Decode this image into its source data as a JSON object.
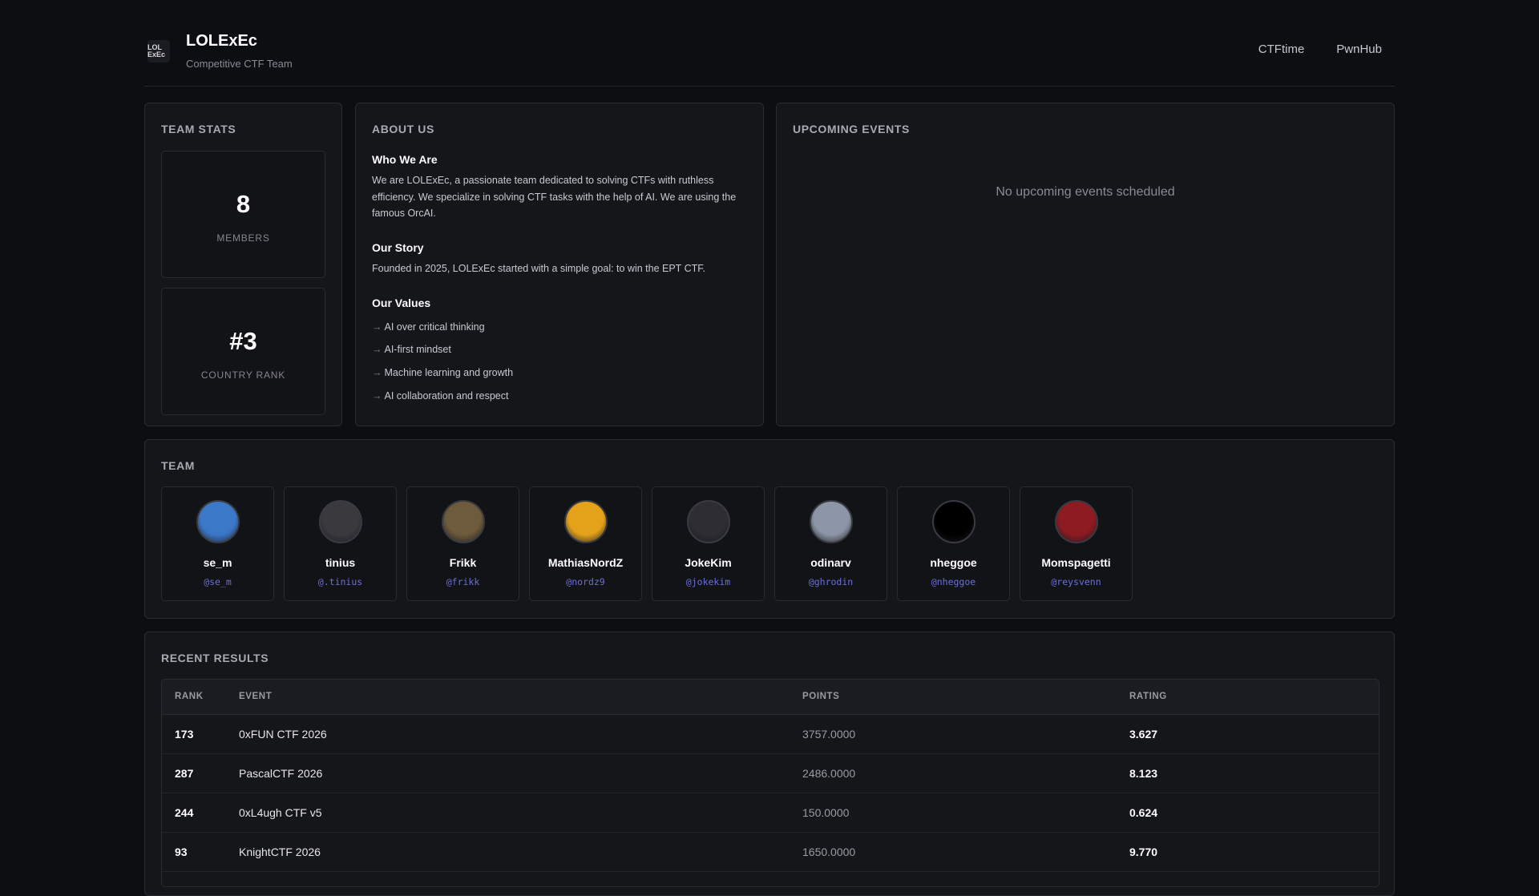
{
  "header": {
    "logo_text": "LOL ExEc",
    "title": "LOLExEc",
    "subtitle": "Competitive CTF Team",
    "nav": [
      {
        "label": "CTFtime"
      },
      {
        "label": "PwnHub"
      }
    ]
  },
  "team_stats": {
    "title": "TEAM STATS",
    "members": {
      "value": "8",
      "label": "MEMBERS"
    },
    "rank": {
      "value": "#3",
      "label": "COUNTRY RANK"
    }
  },
  "about": {
    "title": "ABOUT US",
    "who_heading": "Who We Are",
    "who_text": "We are LOLExEc, a passionate team dedicated to solving CTFs with ruthless efficiency. We specialize in solving CTF tasks with the help of AI. We are using the famous OrcAI.",
    "story_heading": "Our Story",
    "story_text": "Founded in 2025, LOLExEc started with a simple goal: to win the EPT CTF.",
    "values_heading": "Our Values",
    "values": [
      "AI over critical thinking",
      "AI-first mindset",
      "Machine learning and growth",
      "AI collaboration and respect"
    ],
    "arrow": "→"
  },
  "events": {
    "title": "UPCOMING EVENTS",
    "empty_text": "No upcoming events scheduled"
  },
  "team": {
    "title": "TEAM",
    "members": [
      {
        "name": "se_m",
        "handle": "@se_m",
        "color": "#3c78c8"
      },
      {
        "name": "tinius",
        "handle": "@.tinius",
        "color": "#3a3a3e"
      },
      {
        "name": "Frikk",
        "handle": "@frikk",
        "color": "#6e5a3c"
      },
      {
        "name": "MathiasNordZ",
        "handle": "@nordz9",
        "color": "#e3a21a"
      },
      {
        "name": "JokeKim",
        "handle": "@jokekim",
        "color": "#2d2d33"
      },
      {
        "name": "odinarv",
        "handle": "@ghrodin",
        "color": "#8c96a6"
      },
      {
        "name": "nheggoe",
        "handle": "@nheggoe",
        "color": "#000000"
      },
      {
        "name": "Momspagetti",
        "handle": "@reysvenn",
        "color": "#8e1a22"
      }
    ]
  },
  "results": {
    "title": "RECENT RESULTS",
    "columns": [
      "RANK",
      "EVENT",
      "POINTS",
      "RATING"
    ],
    "rows": [
      {
        "rank": "173",
        "event": "0xFUN CTF 2026",
        "points": "3757.0000",
        "rating": "3.627"
      },
      {
        "rank": "287",
        "event": "PascalCTF 2026",
        "points": "2486.0000",
        "rating": "8.123"
      },
      {
        "rank": "244",
        "event": "0xL4ugh CTF v5",
        "points": "150.0000",
        "rating": "0.624"
      },
      {
        "rank": "93",
        "event": "KnightCTF 2026",
        "points": "1650.0000",
        "rating": "9.770"
      }
    ]
  }
}
